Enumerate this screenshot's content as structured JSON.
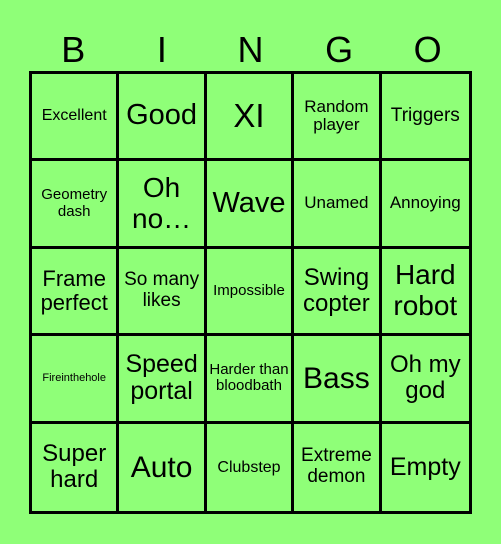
{
  "header": {
    "letters": [
      "B",
      "I",
      "N",
      "G",
      "O"
    ]
  },
  "board": {
    "background_color": "#8fff78",
    "line_color": "#000000",
    "rows": [
      [
        "Excellent",
        "Good",
        "XI",
        "Random player",
        "Triggers"
      ],
      [
        "Geometry dash",
        "Oh no…",
        "Wave",
        "Unamed",
        "Annoying"
      ],
      [
        "Frame perfect",
        "So many likes",
        "Impossible",
        "Swing copter",
        "Hard robot"
      ],
      [
        "Fireinthehole",
        "Speed portal",
        "Harder than bloodbath",
        "Bass",
        "Oh my god"
      ],
      [
        "Super hard",
        "Auto",
        "Clubstep",
        "Extreme demon",
        "Empty"
      ]
    ]
  }
}
